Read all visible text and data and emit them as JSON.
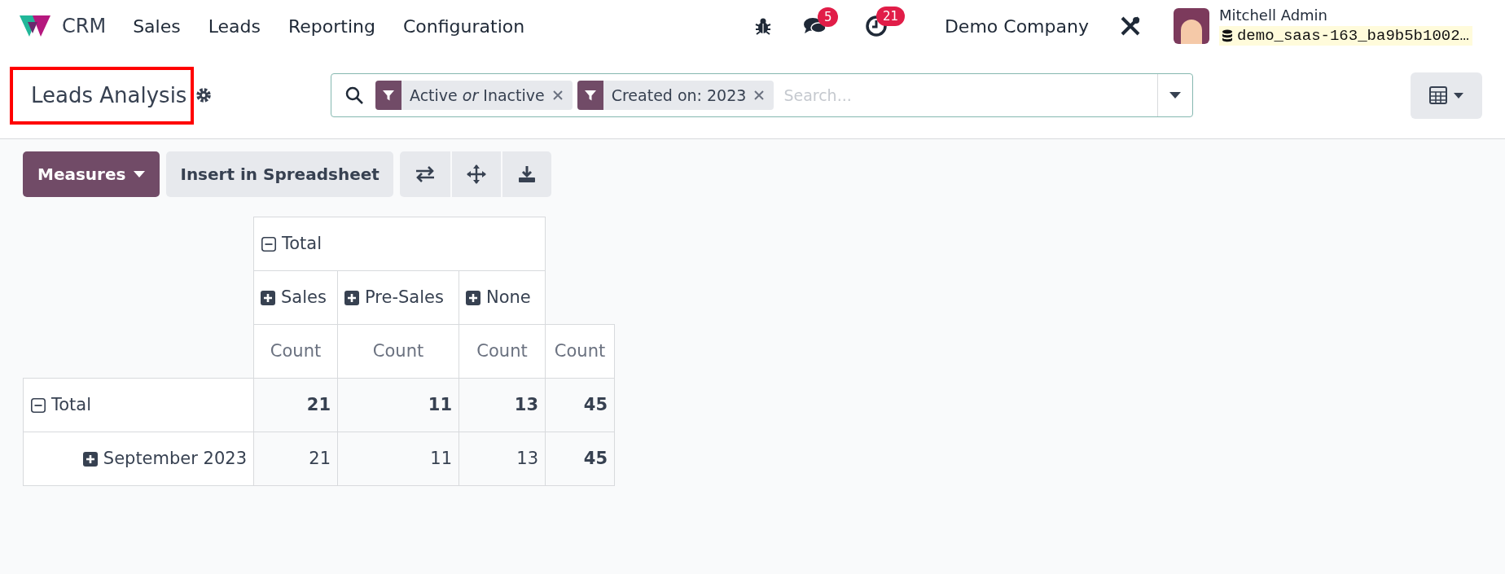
{
  "navbar": {
    "app_name": "CRM",
    "menus": [
      "Sales",
      "Leads",
      "Reporting",
      "Configuration"
    ],
    "messages_badge": "5",
    "activities_badge": "21",
    "company": "Demo Company",
    "user_name": "Mitchell Admin",
    "database": "demo_saas-163_ba9b5b1002…"
  },
  "control_panel": {
    "title": "Leads Analysis",
    "title_highlighted": true,
    "facets": [
      "Active *or* Inactive",
      "Created on: 2023"
    ],
    "search_placeholder": "Search..."
  },
  "toolbar": {
    "measures_button": "Measures",
    "spreadsheet_button": "Insert in Spreadsheet"
  },
  "pivot": {
    "column_header": {
      "label": "Total",
      "expanded": true,
      "children": [
        {
          "label": "Sales",
          "expanded": false
        },
        {
          "label": "Pre-Sales",
          "expanded": false
        },
        {
          "label": "None",
          "expanded": false
        }
      ]
    },
    "measures": [
      "Count",
      "Count",
      "Count",
      "Count"
    ],
    "rows": [
      {
        "label": "Total",
        "expanded": true,
        "values": [
          "21",
          "11",
          "13",
          "45"
        ],
        "children": [
          {
            "label": "September 2023",
            "expanded": false,
            "values": [
              "21",
              "11",
              "13",
              "45"
            ]
          }
        ]
      }
    ]
  }
}
